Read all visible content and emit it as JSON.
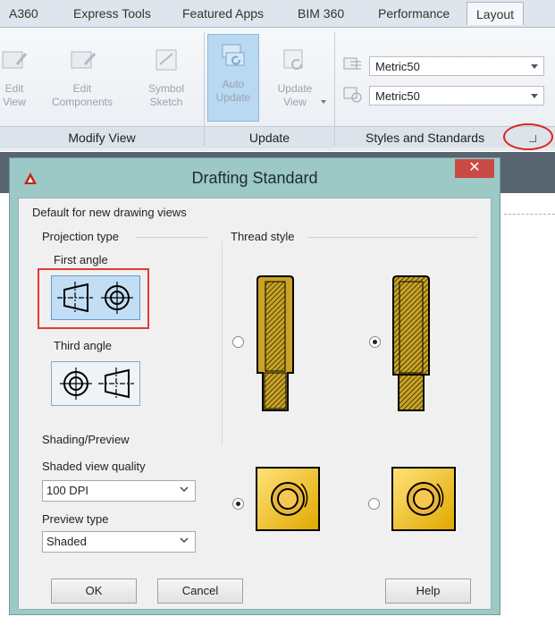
{
  "ribbon": {
    "tabs": [
      "A360",
      "Express Tools",
      "Featured Apps",
      "BIM 360",
      "Performance",
      "Layout"
    ],
    "active_tab": "Layout",
    "modify_view": {
      "title": "Modify View",
      "edit_view": [
        "Edit",
        "View"
      ],
      "edit_components": [
        "Edit",
        "Components"
      ],
      "symbol_sketch": [
        "Symbol",
        "Sketch"
      ]
    },
    "update": {
      "title": "Update",
      "auto_update": [
        "Auto",
        "Update"
      ],
      "update_view": [
        "Update",
        "View"
      ]
    },
    "styles": {
      "title": "Styles and Standards",
      "combo1": "Metric50",
      "combo2": "Metric50"
    }
  },
  "dialog": {
    "title": "Drafting Standard",
    "close_glyph": "✕",
    "section": "Default for new drawing views",
    "projection_type": "Projection type",
    "first_angle": "First angle",
    "third_angle": "Third angle",
    "thread_style": "Thread style",
    "shading_preview": "Shading/Preview",
    "shaded_view_quality_label": "Shaded view quality",
    "shaded_view_quality_value": "100 DPI",
    "preview_type_label": "Preview type",
    "preview_type_value": "Shaded",
    "ok": "OK",
    "cancel": "Cancel",
    "help": "Help"
  },
  "state": {
    "projection_selected": "first_angle",
    "thread_style_selected": 2,
    "shading_selected": 1
  },
  "colors": {
    "accent_red": "#d8261a",
    "selection_blue": "#c2def5",
    "thread_gold": "#c9a325",
    "dialog_frame": "#9cc8c6"
  }
}
